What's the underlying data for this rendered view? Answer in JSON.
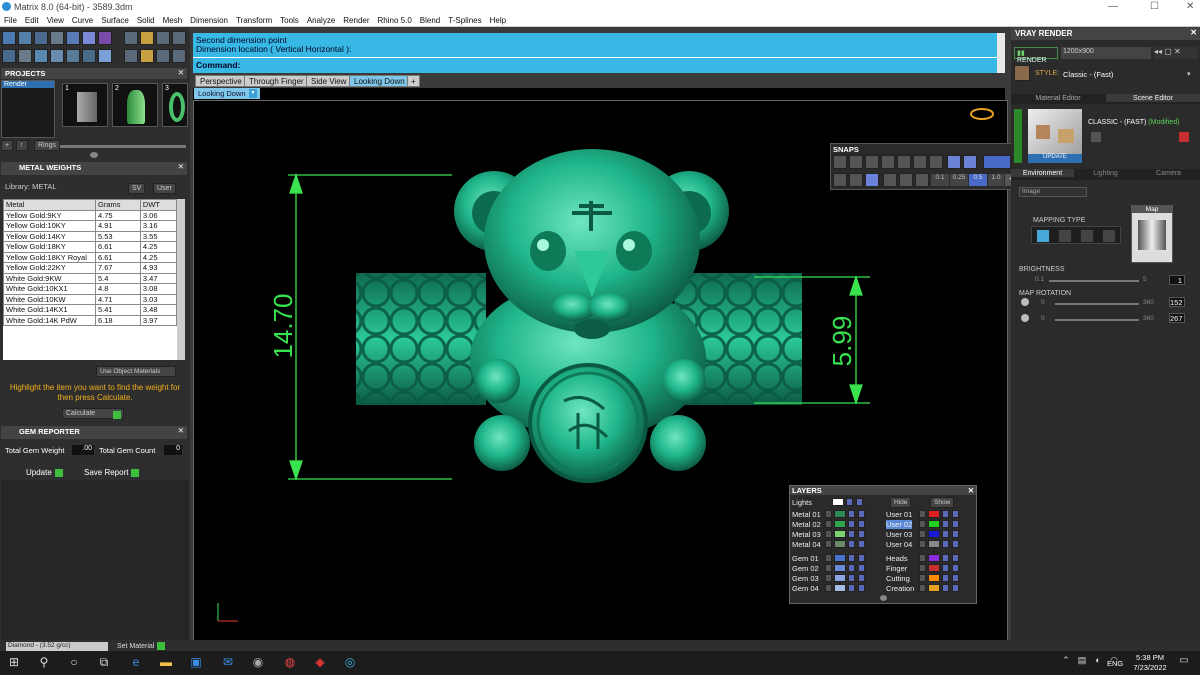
{
  "window": {
    "title": "Matrix 8.0 (64-bit) - 3589.3dm",
    "min": "—",
    "max": "☐",
    "close": "✕"
  },
  "menu": [
    "File",
    "Edit",
    "View",
    "Curve",
    "Surface",
    "Solid",
    "Mesh",
    "Dimension",
    "Transform",
    "Tools",
    "Analyze",
    "Render",
    "Rhino 5.0",
    "Blend",
    "T-Splines",
    "Help"
  ],
  "projects": {
    "title": "PROJECTS",
    "render_label": "Render",
    "thumbs": [
      "1",
      "2",
      "3"
    ],
    "rings_btn": "Rings"
  },
  "metal_weights": {
    "title": "METAL WEIGHTS",
    "library_label": "Library: METAL",
    "sv_label": "SV",
    "user_label": "User",
    "headers": [
      "Metal",
      "Grams",
      "DWT"
    ],
    "rows": [
      [
        "Yellow Gold:9KY",
        "4.75",
        "3.06"
      ],
      [
        "Yellow Gold:10KY",
        "4.91",
        "3.16"
      ],
      [
        "Yellow Gold:14KY",
        "5.53",
        "3.55"
      ],
      [
        "Yellow Gold:18KY",
        "6.61",
        "4.25"
      ],
      [
        "Yellow Gold:18KY Royal",
        "6.61",
        "4.25"
      ],
      [
        "Yellow Gold:22KY",
        "7.67",
        "4.93"
      ],
      [
        "White Gold:9KW",
        "5.4",
        "3.47"
      ],
      [
        "White Gold:10KX1",
        "4.8",
        "3.08"
      ],
      [
        "White Gold:10KW",
        "4.71",
        "3.03"
      ],
      [
        "White Gold:14KX1",
        "5.41",
        "3.48"
      ],
      [
        "White Gold:14K PdW",
        "6.18",
        "3.97"
      ]
    ],
    "use_object_materials": "Use Object Materials",
    "hint": "Highlight the item you want to find the weight for then press Calculate.",
    "calculate": "Calculate"
  },
  "gem_reporter": {
    "title": "GEM REPORTER",
    "total_weight_label": "Total Gem Weight",
    "total_weight": ".00",
    "total_count_label": "Total Gem Count",
    "total_count": "0",
    "update": "Update",
    "save_report": "Save Report"
  },
  "bottom_left": {
    "diamond": "Diamond - (3.52 g/cc)",
    "set_material": "Set Material"
  },
  "command": {
    "line1": "Second dimension point",
    "line2": "Dimension location ( Vertical  Horizontal ):",
    "prompt": "Command:"
  },
  "viewport_tabs": [
    "Perspective",
    "Through Finger",
    "Side View",
    "Looking Down",
    "+"
  ],
  "active_view": "Looking Down",
  "dimensions": {
    "height": "14.70",
    "width": "5.99"
  },
  "model_color": "#1fb58a",
  "snaps": {
    "title": "SNAPS",
    "values": [
      "0.1",
      "0.25",
      "0.5",
      "1.0"
    ]
  },
  "layers": {
    "title": "LAYERS",
    "lights": "Lights",
    "hide": "Hide",
    "show": "Show",
    "left": [
      {
        "name": "Metal 01",
        "color": "#2e8b57"
      },
      {
        "name": "Metal 02",
        "color": "#2aa84a"
      },
      {
        "name": "Metal 03",
        "color": "#7ccf6a"
      },
      {
        "name": "Metal 04",
        "color": "#6a8a6a"
      },
      {
        "name": "Gem 01",
        "color": "#4a70c8"
      },
      {
        "name": "Gem 02",
        "color": "#6a8ad8"
      },
      {
        "name": "Gem 03",
        "color": "#8aa6e0"
      },
      {
        "name": "Gem 04",
        "color": "#a6bce8"
      }
    ],
    "right": [
      {
        "name": "User 01",
        "color": "#e02020"
      },
      {
        "name": "User 02",
        "color": "#22d022"
      },
      {
        "name": "User 03",
        "color": "#1818d8"
      },
      {
        "name": "User 04",
        "color": "#888888"
      },
      {
        "name": "Heads",
        "color": "#8a2be2"
      },
      {
        "name": "Finger",
        "color": "#c83030"
      },
      {
        "name": "Cutting",
        "color": "#ff8c00"
      },
      {
        "name": "Creation",
        "color": "#e8a020"
      }
    ]
  },
  "vray": {
    "title": "VRAY RENDER",
    "render_btn": "RENDER",
    "resolution": "1200x900",
    "style_label": "STYLE:",
    "style_value": "Classic - (Fast)",
    "material_editor": "Material Editor",
    "scene_editor": "Scene Editor",
    "classic_label": "CLASSIC - (FAST)",
    "modified": "(Modified)",
    "update": "UPDATE",
    "env_tabs": [
      "Environment",
      "Lighting",
      "Camera"
    ],
    "image_select": "Image",
    "map_label": "Map",
    "mapping_type": "MAPPING TYPE",
    "brightness": "BRIGHTNESS",
    "bright_min": "0.1",
    "bright_max": "5",
    "bright_val": "1",
    "map_rotation": "MAP ROTATION",
    "rot1_min": "0",
    "rot1_max": "360",
    "rot1_val": "152",
    "rot2_min": "0",
    "rot2_max": "360",
    "rot2_val": "267"
  },
  "taskbar": {
    "lang": "ENG",
    "time": "5:38 PM",
    "date": "7/23/2022"
  }
}
